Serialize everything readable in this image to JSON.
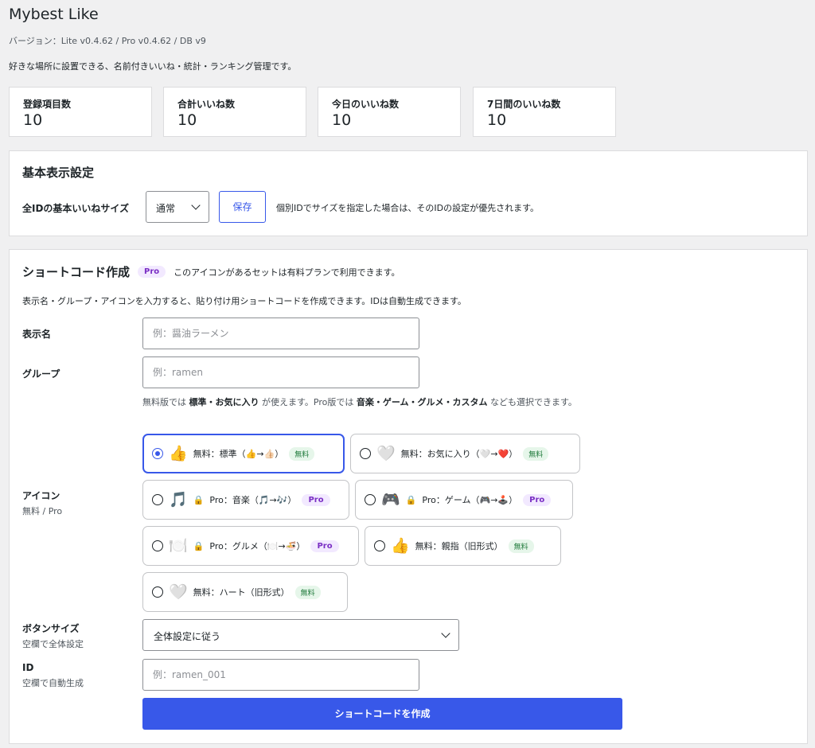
{
  "header": {
    "title": "Mybest Like",
    "version": "バージョン：Lite v0.4.62 / Pro v0.4.62 / DB v9",
    "description": "好きな場所に設置できる、名前付きいいね・統計・ランキング管理です。"
  },
  "stats": [
    {
      "label": "登録項目数",
      "value": "10"
    },
    {
      "label": "合計いいね数",
      "value": "10"
    },
    {
      "label": "今日のいいね数",
      "value": "10"
    },
    {
      "label": "7日間のいいね数",
      "value": "10"
    }
  ],
  "basic": {
    "title": "基本表示設定",
    "size_label": "全IDの基本いいねサイズ",
    "size_value": "通常",
    "save_label": "保存",
    "note": "個別IDでサイズを指定した場合は、そのIDの設定が優先されます。"
  },
  "shortcode": {
    "title": "ショートコード作成",
    "pro_badge": "Pro",
    "pro_note": "このアイコンがあるセットは有料プランで利用できます。",
    "intro": "表示名・グループ・アイコンを入力すると、貼り付け用ショートコードを作成できます。IDは自動生成できます。",
    "name_label": "表示名",
    "name_placeholder": "例：醤油ラーメン",
    "group_label": "グループ",
    "group_placeholder": "例：ramen",
    "help_1": "無料版では ",
    "help_bold_1": "標準・お気に入り",
    "help_2": " が使えます。Pro版では ",
    "help_bold_2": "音楽・ゲーム・グルメ・カスタム",
    "help_3": " なども選択できます。",
    "icon_label": "アイコン",
    "icon_sub": "無料 / Pro",
    "icon_options": [
      {
        "emoji": "👍",
        "text": "無料：標準（👍→👍🏻）",
        "badge": "無料",
        "selected": true
      },
      {
        "emoji": "🤍",
        "text": "無料：お気に入り（🤍→❤️）",
        "badge": "無料",
        "selected": false
      },
      {
        "emoji": "🎵",
        "lock": "🔒",
        "text": "Pro：音楽（🎵→🎶）",
        "badge": "Pro",
        "selected": false
      },
      {
        "emoji": "🎮",
        "lock": "🔒",
        "text": "Pro：ゲーム（🎮→🕹️）",
        "badge": "Pro",
        "selected": false
      },
      {
        "emoji": "🍽️",
        "lock": "🔒",
        "text": "Pro：グルメ（🍽️→🍜）",
        "badge": "Pro",
        "selected": false
      },
      {
        "emoji": "👍",
        "text": "無料：親指（旧形式）",
        "badge": "無料",
        "selected": false
      },
      {
        "emoji": "🤍",
        "text": "無料：ハート（旧形式）",
        "badge": "無料",
        "selected": false
      }
    ],
    "button_size_label": "ボタンサイズ",
    "button_size_sub": "空欄で全体設定",
    "button_size_value": "全体設定に従う",
    "id_label": "ID",
    "id_sub": "空欄で自動生成",
    "id_placeholder": "例：ramen_001",
    "submit_label": "ショートコードを作成"
  }
}
